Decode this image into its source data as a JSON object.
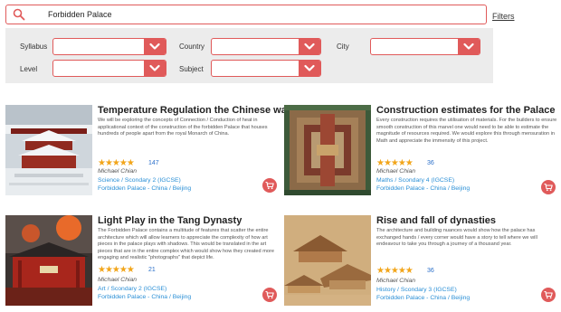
{
  "search": {
    "value": "Forbidden Palace",
    "placeholder": ""
  },
  "filters_link": "Filters",
  "filter_panel": {
    "syllabus_label": "Syllabus",
    "country_label": "Country",
    "city_label": "City",
    "level_label": "Level",
    "subject_label": "Subject"
  },
  "cards": [
    {
      "title": "Temperature Regulation the Chinese way",
      "description": "We will be exploring the concepts of Connection / Conduction of heat in applicational context of the construction of the forbidden Palace that houses hundreds of people apart from the royal Monarch of China.",
      "stars": "★★★★★",
      "rating": 5,
      "rating_count": "147",
      "author": "Michael Chian",
      "course": "Science / Scondary 2 (IGCSE)",
      "location": "Forbidden Palace - China / Beijing",
      "thumb": "snow-palace"
    },
    {
      "title": "Construction estimates for the Palace",
      "description": "Every construction requires the utilisation of materials. For the builders to ensure smooth construction of this marvel one would need to be able to estimate the magnitude of resources required. We would explore this through mensuration in Math and appreciate the immensity of this project.",
      "stars": "★★★★★",
      "rating": 5,
      "rating_count": "36",
      "author": "Michael Chian",
      "course": "Maths / Scondary 4 (IGCSE)",
      "location": "Forbidden Palace - China / Beijing",
      "thumb": "aerial-palace"
    },
    {
      "title": "Light Play in the Tang Dynasty",
      "description": "The Forbidden Palace contains a multitude of features that scatter the entire architecture which will allow learners to appreciate the complexity of how art pieces in the palace plays with shadows. This would be translated in the art pieces that are in the entire complex which would show how they created more engaging and realistic \"photographs\" that depict life.",
      "stars": "★★★★★",
      "rating": 5,
      "rating_count": "21",
      "author": "Michael Chian",
      "course": "Art / Scondary 2 (IGCSE)",
      "location": "Forbidden Palace - China / Beijing",
      "thumb": "gate-sunset"
    },
    {
      "title": "Rise and fall of dynasties",
      "description": "The architecture and building nuances would show how the palace has exchanged hands / every corner would have a story to tell where we will endeavour to take you through a journey of a thousand year.",
      "stars": "★★★★★",
      "rating": 5,
      "rating_count": "36",
      "author": "Michael Chian",
      "course": "History / Scondary 3 (IGCSE)",
      "location": "Forbidden Palace - China / Beijing",
      "thumb": "painting-scroll"
    }
  ],
  "colors": {
    "accent": "#e05a5a",
    "link": "#2a8fd6",
    "star": "#f2a51a",
    "panel": "#ececec"
  },
  "icons": {
    "search": "search-icon",
    "dropdown": "chevron-down-icon",
    "cart": "cart-icon"
  }
}
